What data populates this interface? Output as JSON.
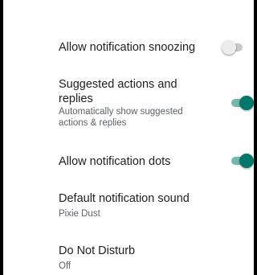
{
  "colors": {
    "accent": "#00796b",
    "accent_track": "#6fb9ad",
    "switch_off_thumb": "#ececec",
    "switch_off_track": "#c8c8c8",
    "title_text": "#202124",
    "summary_text": "#5f6368"
  },
  "settings": {
    "snoozing": {
      "title": "Allow notification snoozing",
      "enabled": false
    },
    "suggested": {
      "title": "Suggested actions and replies",
      "summary": "Automatically show suggested actions & replies",
      "enabled": true
    },
    "dots": {
      "title": "Allow notification dots",
      "enabled": true
    },
    "sound": {
      "title": "Default notification sound",
      "summary": "Pixie Dust"
    },
    "dnd": {
      "title": "Do Not Disturb",
      "summary": "Off"
    }
  }
}
